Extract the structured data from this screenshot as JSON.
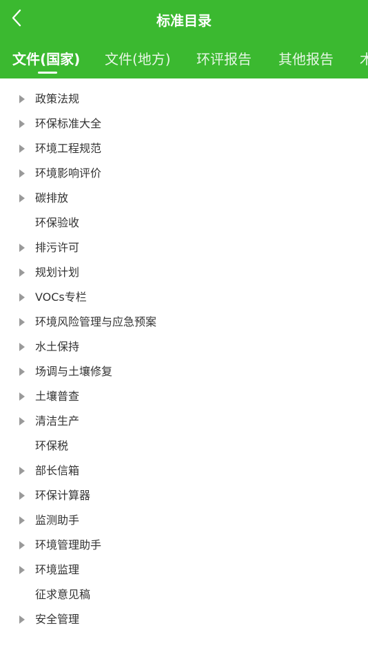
{
  "header": {
    "title": "标准目录"
  },
  "tabs": [
    {
      "label": "文件(国家)",
      "active": true
    },
    {
      "label": "文件(地方)",
      "active": false
    },
    {
      "label": "环评报告",
      "active": false
    },
    {
      "label": "其他报告",
      "active": false
    },
    {
      "label": "木",
      "active": false
    }
  ],
  "items": [
    {
      "label": "政策法规",
      "expandable": true
    },
    {
      "label": "环保标准大全",
      "expandable": true
    },
    {
      "label": "环境工程规范",
      "expandable": true
    },
    {
      "label": "环境影响评价",
      "expandable": true
    },
    {
      "label": "碳排放",
      "expandable": true
    },
    {
      "label": "环保验收",
      "expandable": false
    },
    {
      "label": "排污许可",
      "expandable": true
    },
    {
      "label": "规划计划",
      "expandable": true
    },
    {
      "label": "VOCs专栏",
      "expandable": true
    },
    {
      "label": "环境风险管理与应急预案",
      "expandable": true
    },
    {
      "label": "水土保持",
      "expandable": true
    },
    {
      "label": "场调与土壤修复",
      "expandable": true
    },
    {
      "label": "土壤普查",
      "expandable": true
    },
    {
      "label": "清洁生产",
      "expandable": true
    },
    {
      "label": "环保税",
      "expandable": false
    },
    {
      "label": "部长信箱",
      "expandable": true
    },
    {
      "label": "环保计算器",
      "expandable": true
    },
    {
      "label": "监测助手",
      "expandable": true
    },
    {
      "label": "环境管理助手",
      "expandable": true
    },
    {
      "label": "环境监理",
      "expandable": true
    },
    {
      "label": "征求意见稿",
      "expandable": false
    },
    {
      "label": "安全管理",
      "expandable": true
    }
  ],
  "colors": {
    "header_bg": "#3bb930",
    "text": "#333333",
    "arrow": "#9a9a9a"
  }
}
